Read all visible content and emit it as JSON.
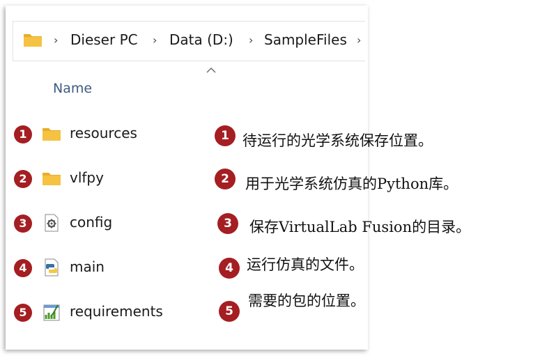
{
  "address_bar": {
    "breadcrumbs": [
      "Dieser PC",
      "Data (D:)",
      "SampleFiles"
    ],
    "folder_icon": "folder-icon",
    "separator_icon": "chevron-right-icon"
  },
  "file_list": {
    "sort_indicator": "sort-ascending-icon",
    "column_header": "Name",
    "items": [
      {
        "badge": "1",
        "name": "resources",
        "icon": "folder-icon"
      },
      {
        "badge": "2",
        "name": "vlfpy",
        "icon": "folder-icon"
      },
      {
        "badge": "3",
        "name": "config",
        "icon": "config-file-icon"
      },
      {
        "badge": "4",
        "name": "main",
        "icon": "python-file-icon"
      },
      {
        "badge": "5",
        "name": "requirements",
        "icon": "text-file-icon"
      }
    ]
  },
  "annotations": [
    {
      "badge": "1",
      "text": "待运行的光学系统保存位置。"
    },
    {
      "badge": "2",
      "text": "用于光学系统仿真的Python库。"
    },
    {
      "badge": "3",
      "text": "保存VirtualLab Fusion的目录。"
    },
    {
      "badge": "4",
      "text": "运行仿真的文件。"
    },
    {
      "badge": "5",
      "text": "需要的包的位置。"
    }
  ],
  "colors": {
    "badge": "#a41e22",
    "folder": "#f5c242",
    "header_text": "#3d5a80"
  }
}
